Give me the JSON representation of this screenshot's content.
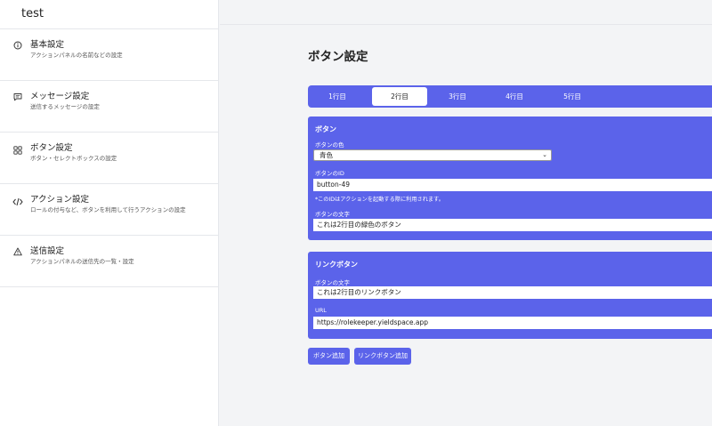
{
  "app": {
    "title": "test"
  },
  "sidebar": {
    "items": [
      {
        "icon": "info-icon",
        "title": "基本設定",
        "subtitle": "アクションパネルの名前などの設定"
      },
      {
        "icon": "message-icon",
        "title": "メッセージ設定",
        "subtitle": "送信するメッセージの設定"
      },
      {
        "icon": "grid-icon",
        "title": "ボタン設定",
        "subtitle": "ボタン・セレクトボックスの設定"
      },
      {
        "icon": "code-icon",
        "title": "アクション設定",
        "subtitle": "ロールの付与など、ボタンを利用して行うアクションの設定"
      },
      {
        "icon": "warning-icon",
        "title": "送信設定",
        "subtitle": "アクションパネルの送信先の一覧・設定"
      }
    ]
  },
  "main": {
    "page_title": "ボタン設定",
    "tabs": [
      "1行目",
      "2行目",
      "3行目",
      "4行目",
      "5行目"
    ],
    "active_tab": "2行目",
    "button_card": {
      "title": "ボタン",
      "color_label": "ボタンの色",
      "color_value": "青色",
      "id_label": "ボタンのID",
      "id_value": "button-49",
      "id_note": "*このIDはアクションを起動する際に利用されます。",
      "text_label": "ボタンの文字",
      "text_value": "これは2行目の緑色のボタン"
    },
    "link_card": {
      "title": "リンクボタン",
      "text_label": "ボタンの文字",
      "text_value": "これは2行目のリンクボタン",
      "url_label": "URL",
      "url_value": "https://rolekeeper.yieldspace.app"
    },
    "add_button_label": "ボタン追加",
    "add_link_button_label": "リンクボタン追加"
  },
  "colors": {
    "accent": "#5b63ea",
    "sidebar_bg": "#ffffff",
    "main_bg": "#f3f4f6"
  }
}
